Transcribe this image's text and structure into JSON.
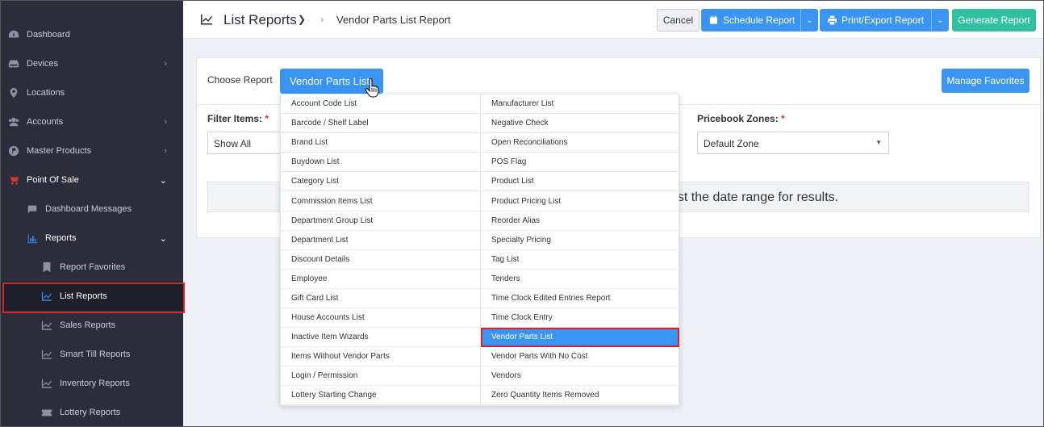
{
  "sidebar": {
    "items": [
      {
        "label": "Dashboard",
        "icon": "dashboard-icon"
      },
      {
        "label": "Devices",
        "icon": "devices-icon"
      },
      {
        "label": "Locations",
        "icon": "location-icon"
      },
      {
        "label": "Accounts",
        "icon": "accounts-icon"
      },
      {
        "label": "Master Products",
        "icon": "master-products-icon"
      },
      {
        "label": "Point Of Sale",
        "icon": "cart-icon"
      },
      {
        "label": "Dashboard Messages",
        "icon": "messages-icon"
      },
      {
        "label": "Reports",
        "icon": "bar-chart-icon"
      },
      {
        "label": "Report Favorites",
        "icon": "bookmark-icon"
      },
      {
        "label": "List Reports",
        "icon": "line-chart-icon"
      },
      {
        "label": "Sales Reports",
        "icon": "line-chart-icon"
      },
      {
        "label": "Smart Till Reports",
        "icon": "line-chart-icon"
      },
      {
        "label": "Inventory Reports",
        "icon": "line-chart-icon"
      },
      {
        "label": "Lottery Reports",
        "icon": "ticket-icon"
      }
    ]
  },
  "header": {
    "title": "List Reports",
    "breadcrumb": "Vendor Parts List Report",
    "cancel_label": "Cancel",
    "schedule_label": "Schedule Report",
    "print_label": "Print/Export Report",
    "generate_label": "Generate Report"
  },
  "main": {
    "choose_label": "Choose Report",
    "report_selected": "Vendor Parts List",
    "manage_favorites_label": "Manage Favorites",
    "filter_items_label": "Filter Items:",
    "filter_items_value": "Show All",
    "pricebook_zones_label": "Pricebook Zones:",
    "pricebook_zones_value": "Default Zone",
    "required_mark": "*",
    "message_fragment": "ust the date range for results."
  },
  "dropdown": {
    "left": [
      "Account Code List",
      "Barcode / Shelf Label",
      "Brand List",
      "Buydown List",
      "Category List",
      "Commission Items List",
      "Department Group List",
      "Department List",
      "Discount Details",
      "Employee",
      "Gift Card List",
      "House Accounts List",
      "Inactive Item Wizards",
      "Items Without Vendor Parts",
      "Login / Permission",
      "Lottery Starting Change"
    ],
    "right": [
      "Manufacturer List",
      "Negative Check",
      "Open Reconciliations",
      "POS Flag",
      "Product List",
      "Product Pricing List",
      "Reorder Alias",
      "Specialty Pricing",
      "Tag List",
      "Tenders",
      "Time Clock Edited Entries Report",
      "Time Clock Entry",
      "Vendor Parts List",
      "Vendor Parts With No Cost",
      "Vendors",
      "Zero Quantity Items Removed"
    ]
  },
  "colors": {
    "sidebar_bg": "#2b2d3b",
    "primary_blue": "#3a95f2",
    "generate_green": "#31c0a0",
    "highlight_red": "#d7232b"
  }
}
